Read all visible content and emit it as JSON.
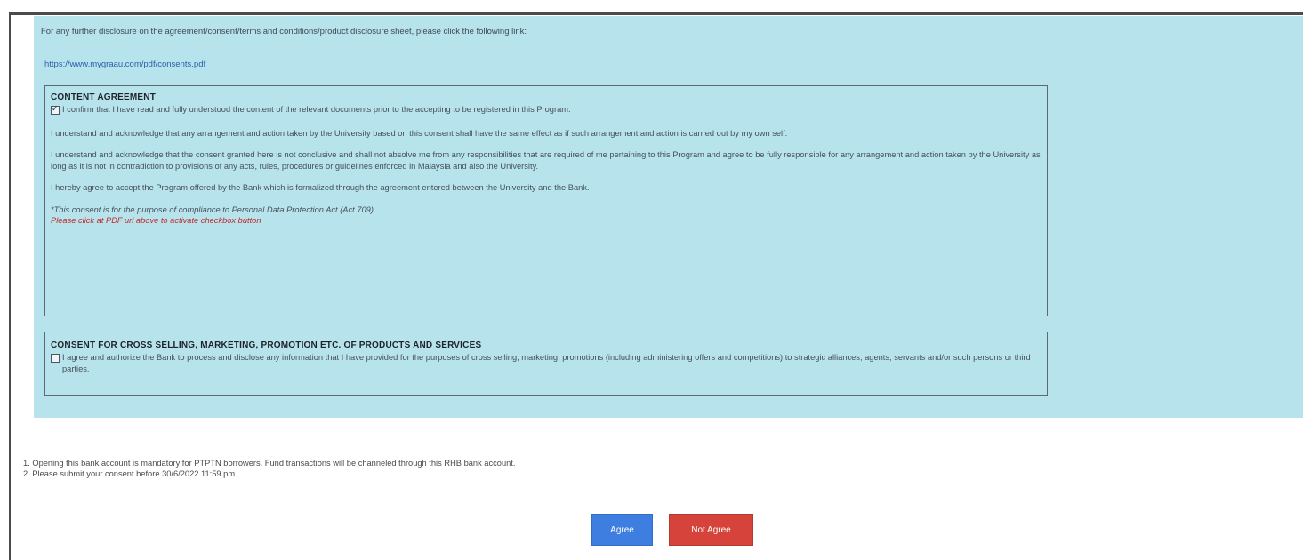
{
  "intro": {
    "text": "For any further disclosure on the agreement/consent/terms and conditions/product disclosure sheet, please click the following link:",
    "link": "https://www.mygraau.com/pdf/consents.pdf"
  },
  "content_agreement": {
    "title": "CONTENT AGREEMENT",
    "checkbox_checked": true,
    "paragraphs": [
      "I confirm that I have read and fully understood the content of the relevant documents prior to the accepting to be registered in this Program.",
      "I understand and acknowledge that any arrangement and action taken by the University based on this consent shall have the same effect as if such arrangement and action is carried out by my own self.",
      "I understand and acknowledge that the consent granted here is not conclusive and shall not absolve me from any responsibilities that are required of me pertaining to this Program and agree to be fully responsible for any arrangement and action taken by the University as long as it is not in contradiction to provisions of any acts, rules, procedures or guidelines enforced in Malaysia and also the University.",
      "I hereby agree to accept the Program offered by the Bank which is formalized through the agreement entered between the University and the Bank."
    ],
    "italic_note": "*This consent is for the purpose of compliance to Personal Data Protection Act (Act 709)",
    "red_note": "Please click at PDF url above to activate checkbox button"
  },
  "cross_selling": {
    "title": "CONSENT FOR CROSS SELLING, MARKETING, PROMOTION ETC. OF PRODUCTS AND SERVICES",
    "checkbox_checked": false,
    "text": "I agree and authorize the Bank to process and disclose any information that I have provided for the purposes of cross selling, marketing, promotions (including administering offers and competitions) to strategic alliances, agents, servants and/or such persons or third parties."
  },
  "notes": [
    "1. Opening this bank account is mandatory for PTPTN borrowers. Fund transactions will be channeled through this RHB bank account.",
    "2. Please submit your consent before 30/6/2022 11:59 pm"
  ],
  "buttons": {
    "agree": "Agree",
    "not_agree": "Not Agree"
  },
  "colors": {
    "panel_bg": "#b7e3ec",
    "agree_bg": "#3d7ee0",
    "not_agree_bg": "#d5433a",
    "red_note": "#c12a2a"
  }
}
